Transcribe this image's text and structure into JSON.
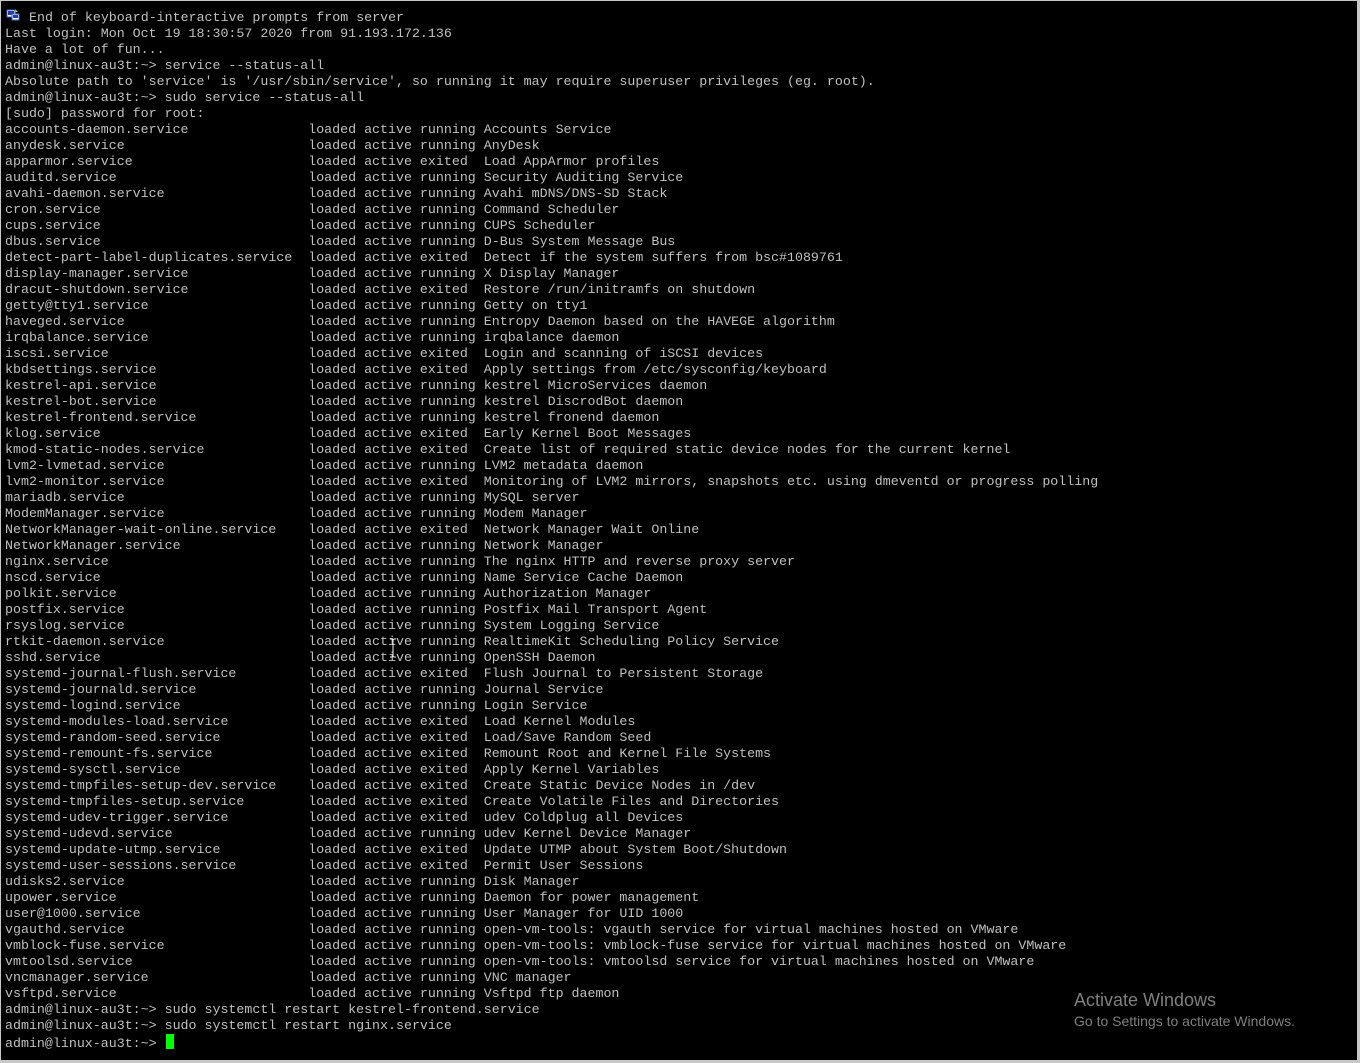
{
  "terminal": {
    "lines": [
      "End of keyboard-interactive prompts from server",
      "Last login: Mon Oct 19 18:30:57 2020 from 91.193.172.136",
      "Have a lot of fun...",
      "admin@linux-au3t:~> service --status-all",
      "Absolute path to 'service' is '/usr/sbin/service', so running it may require superuser privileges (eg. root).",
      "admin@linux-au3t:~> sudo service --status-all",
      "[sudo] password for root:",
      "accounts-daemon.service               loaded active running Accounts Service",
      "anydesk.service                       loaded active running AnyDesk",
      "apparmor.service                      loaded active exited  Load AppArmor profiles",
      "auditd.service                        loaded active running Security Auditing Service",
      "avahi-daemon.service                  loaded active running Avahi mDNS/DNS-SD Stack",
      "cron.service                          loaded active running Command Scheduler",
      "cups.service                          loaded active running CUPS Scheduler",
      "dbus.service                          loaded active running D-Bus System Message Bus",
      "detect-part-label-duplicates.service  loaded active exited  Detect if the system suffers from bsc#1089761",
      "display-manager.service               loaded active running X Display Manager",
      "dracut-shutdown.service               loaded active exited  Restore /run/initramfs on shutdown",
      "getty@tty1.service                    loaded active running Getty on tty1",
      "haveged.service                       loaded active running Entropy Daemon based on the HAVEGE algorithm",
      "irqbalance.service                    loaded active running irqbalance daemon",
      "iscsi.service                         loaded active exited  Login and scanning of iSCSI devices",
      "kbdsettings.service                   loaded active exited  Apply settings from /etc/sysconfig/keyboard",
      "kestrel-api.service                   loaded active running kestrel MicroServices daemon",
      "kestrel-bot.service                   loaded active running kestrel DiscrodBot daemon",
      "kestrel-frontend.service              loaded active running kestrel fronend daemon",
      "klog.service                          loaded active exited  Early Kernel Boot Messages",
      "kmod-static-nodes.service             loaded active exited  Create list of required static device nodes for the current kernel",
      "lvm2-lvmetad.service                  loaded active running LVM2 metadata daemon",
      "lvm2-monitor.service                  loaded active exited  Monitoring of LVM2 mirrors, snapshots etc. using dmeventd or progress polling",
      "mariadb.service                       loaded active running MySQL server",
      "ModemManager.service                  loaded active running Modem Manager",
      "NetworkManager-wait-online.service    loaded active exited  Network Manager Wait Online",
      "NetworkManager.service                loaded active running Network Manager",
      "nginx.service                         loaded active running The nginx HTTP and reverse proxy server",
      "nscd.service                          loaded active running Name Service Cache Daemon",
      "polkit.service                        loaded active running Authorization Manager",
      "postfix.service                       loaded active running Postfix Mail Transport Agent",
      "rsyslog.service                       loaded active running System Logging Service",
      "rtkit-daemon.service                  loaded active running RealtimeKit Scheduling Policy Service",
      "sshd.service                          loaded active running OpenSSH Daemon",
      "systemd-journal-flush.service         loaded active exited  Flush Journal to Persistent Storage",
      "systemd-journald.service              loaded active running Journal Service",
      "systemd-logind.service                loaded active running Login Service",
      "systemd-modules-load.service          loaded active exited  Load Kernel Modules",
      "systemd-random-seed.service           loaded active exited  Load/Save Random Seed",
      "systemd-remount-fs.service            loaded active exited  Remount Root and Kernel File Systems",
      "systemd-sysctl.service                loaded active exited  Apply Kernel Variables",
      "systemd-tmpfiles-setup-dev.service    loaded active exited  Create Static Device Nodes in /dev",
      "systemd-tmpfiles-setup.service        loaded active exited  Create Volatile Files and Directories",
      "systemd-udev-trigger.service          loaded active exited  udev Coldplug all Devices",
      "systemd-udevd.service                 loaded active running udev Kernel Device Manager",
      "systemd-update-utmp.service           loaded active exited  Update UTMP about System Boot/Shutdown",
      "systemd-user-sessions.service         loaded active exited  Permit User Sessions",
      "udisks2.service                       loaded active running Disk Manager",
      "upower.service                        loaded active running Daemon for power management",
      "user@1000.service                     loaded active running User Manager for UID 1000",
      "vgauthd.service                       loaded active running open-vm-tools: vgauth service for virtual machines hosted on VMware",
      "vmblock-fuse.service                  loaded active running open-vm-tools: vmblock-fuse service for virtual machines hosted on VMware",
      "vmtoolsd.service                      loaded active running open-vm-tools: vmtoolsd service for virtual machines hosted on VMware",
      "vncmanager.service                    loaded active running VNC manager",
      "vsftpd.service                        loaded active running Vsftpd ftp daemon",
      "admin@linux-au3t:~> sudo systemctl restart kestrel-frontend.service",
      "admin@linux-au3t:~> sudo systemctl restart nginx.service"
    ],
    "prompt": "admin@linux-au3t:~> ",
    "colors": {
      "background": "#000000",
      "text": "#c0c0c0",
      "cursor": "#00ff00"
    }
  },
  "watermark": {
    "title": "Activate Windows",
    "subtitle": "Go to Settings to activate Windows."
  },
  "icons": {
    "window_icon": "putty-icon",
    "mouse_cursor": "text-cursor-icon"
  }
}
